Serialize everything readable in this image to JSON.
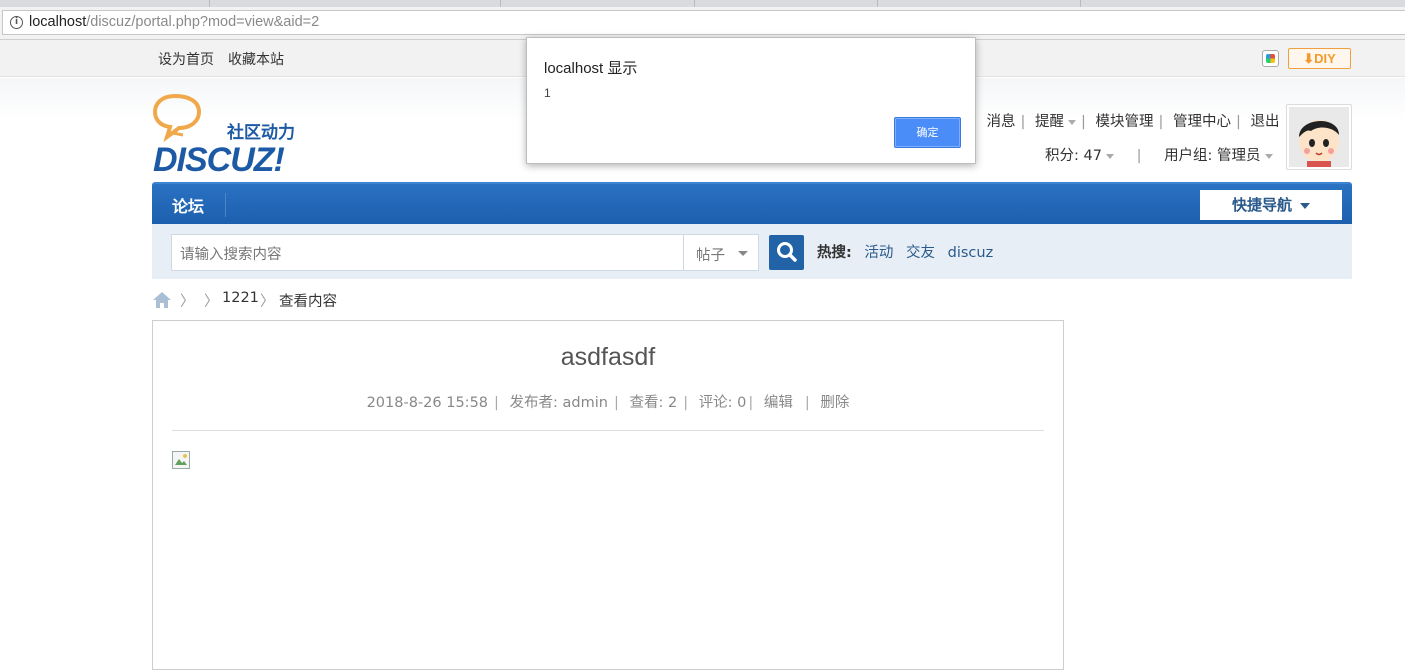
{
  "browser": {
    "url_host": "localhost",
    "url_path": "/discuz/portal.php?mod=view&aid=2"
  },
  "toptb": {
    "set_home": "设为首页",
    "bookmark": "收藏本站",
    "diy_label": "DIY",
    "icons": [
      "color-palette-icon",
      "download-arrow-icon"
    ]
  },
  "logo": {
    "tagline": "社区动力",
    "wordmark": "DISCUZ!"
  },
  "user_menu": {
    "items": [
      "消息",
      "提醒",
      "模块管理",
      "管理中心",
      "退出"
    ],
    "credits": "积分: 47",
    "group": "用户组: 管理员"
  },
  "nav": {
    "forum": "论坛",
    "quick_nav": "快捷导航"
  },
  "search": {
    "placeholder": "请输入搜索内容",
    "type": "帖子",
    "hot_label": "热搜:",
    "hot_terms": [
      "活动",
      "交友",
      "discuz"
    ]
  },
  "breadcrumb": {
    "item1": "1221",
    "item2": "查看内容"
  },
  "article": {
    "title": "asdfasdf",
    "date": "2018-8-26 15:58",
    "author": "发布者: admin",
    "views": "查看: 2",
    "comments": "评论: 0",
    "edit": "编辑",
    "delete": "删除"
  },
  "dialog": {
    "title": "localhost 显示",
    "message": "1",
    "ok": "确定"
  },
  "colors": {
    "nav_blue": "#1c5fae",
    "link_blue": "#2a5a8c",
    "dialog_button": "#4b8df8",
    "diy_orange": "#f39a2b"
  }
}
